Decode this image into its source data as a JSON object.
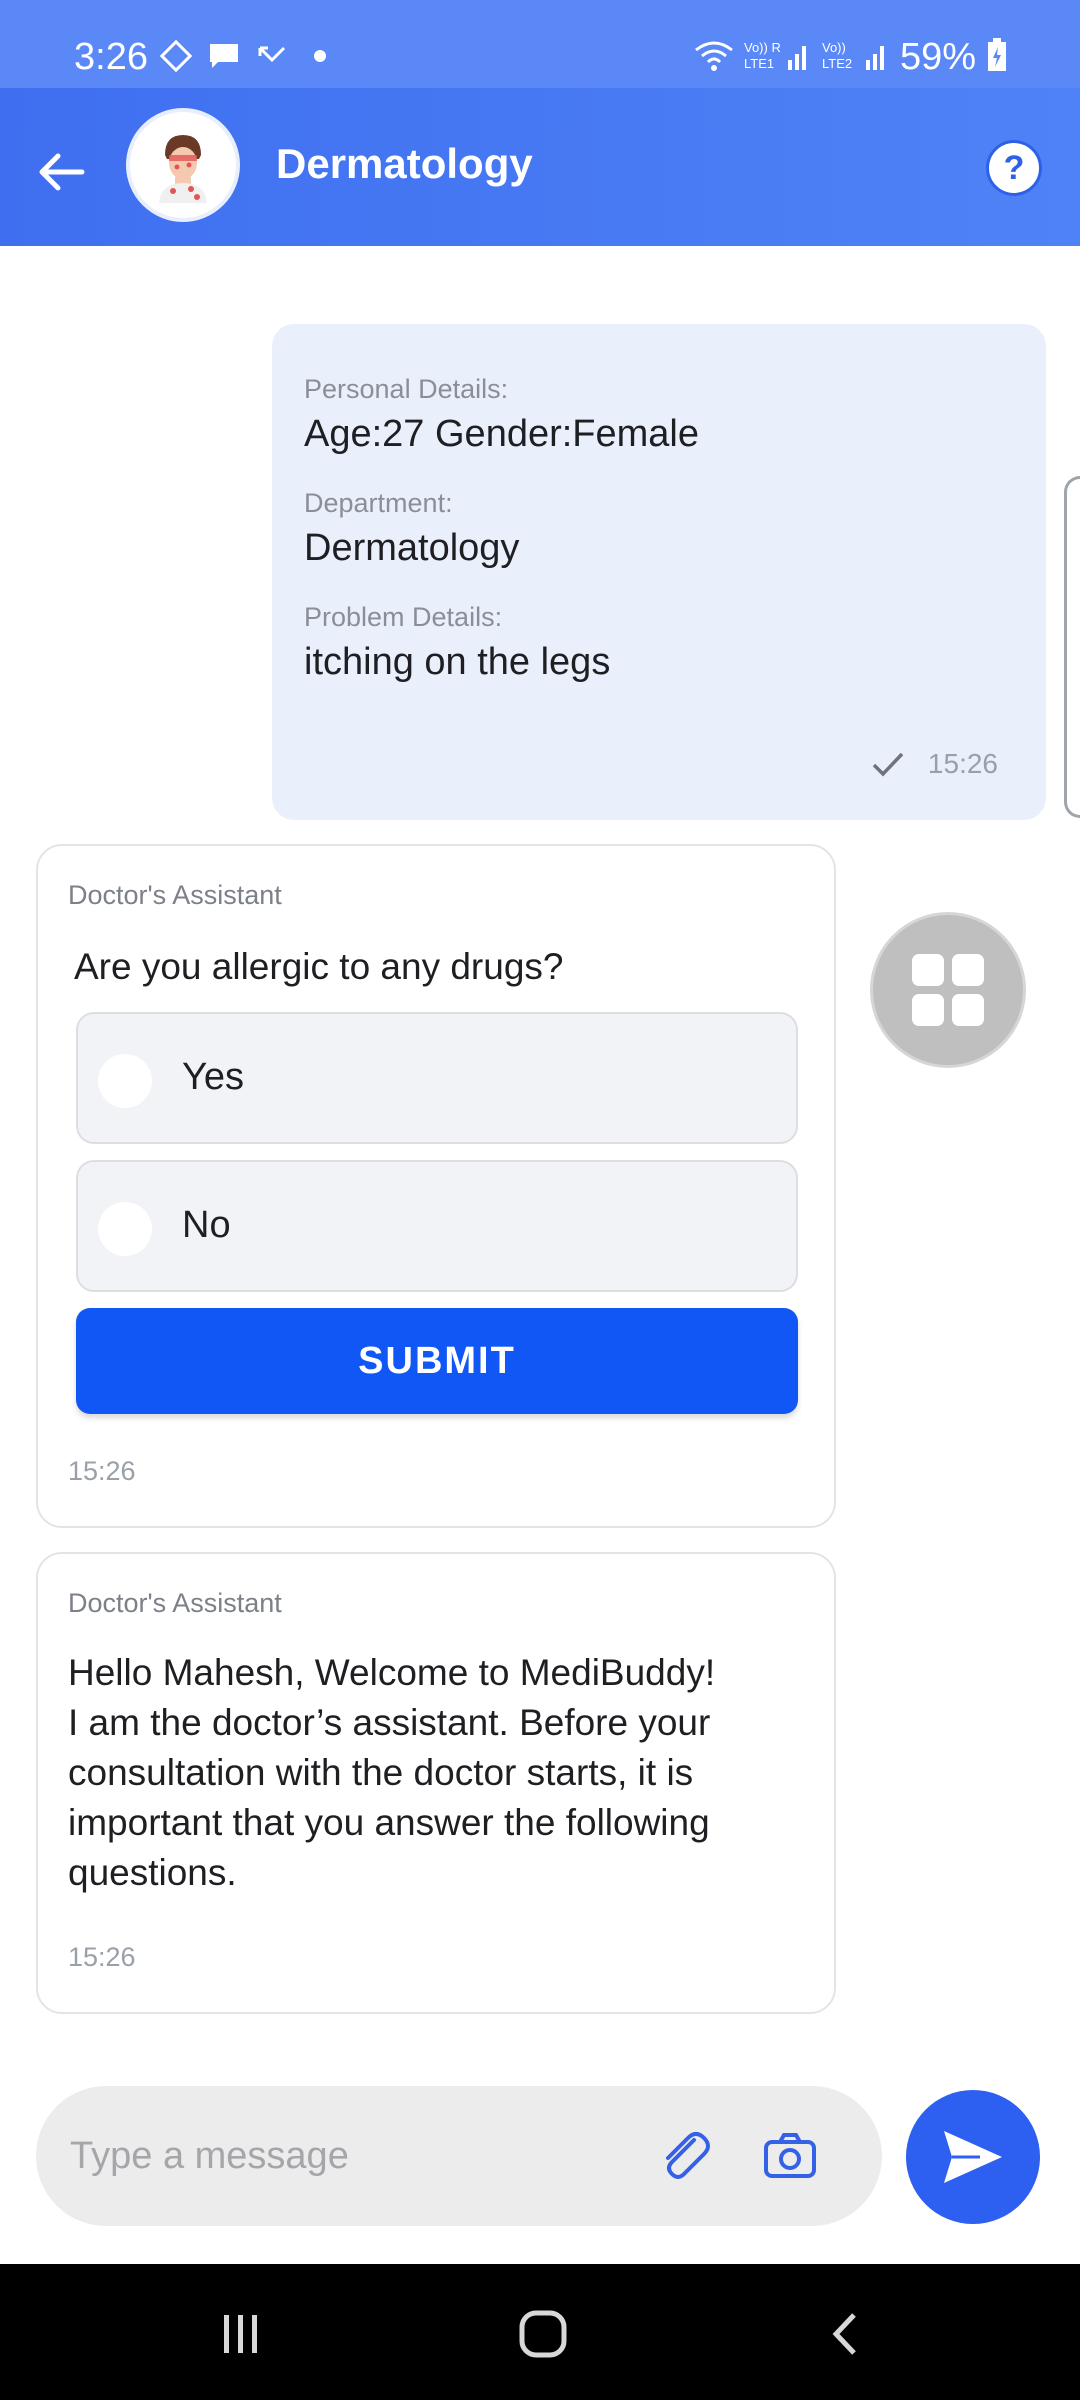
{
  "status_bar": {
    "time": "3:26",
    "battery": "59%",
    "indicators": [
      "wifi-icon",
      "volte-lte1-icon",
      "signal-icon",
      "volte-lte2-icon",
      "signal-icon",
      "battery-icon"
    ]
  },
  "header": {
    "title": "Dermatology",
    "help_label": "?",
    "color": "#4a7cf3"
  },
  "outgoing_message": {
    "fields": [
      {
        "label": "Personal Details:",
        "value": "Age:27 Gender:Female"
      },
      {
        "label": "Department:",
        "value": "Dermatology"
      },
      {
        "label": "Problem Details:",
        "value": "itching on the legs"
      }
    ],
    "time": "15:26",
    "status": "sent"
  },
  "question_card": {
    "sender": "Doctor's Assistant",
    "question": "Are you allergic to any drugs?",
    "options": [
      "Yes",
      "No"
    ],
    "submit_label": "SUBMIT",
    "time": "15:26"
  },
  "welcome_card": {
    "sender": "Doctor's Assistant",
    "text": "Hello Mahesh, Welcome to MediBuddy!\nI am the doctor’s assistant. Before your consultation with the doctor starts, it is important that you answer the following questions.",
    "time": "15:26"
  },
  "composer": {
    "placeholder": "Type a message"
  },
  "colors": {
    "accent": "#1157f5",
    "header": "#4a7cf3",
    "outgoing_bubble": "#eaf0fb"
  }
}
